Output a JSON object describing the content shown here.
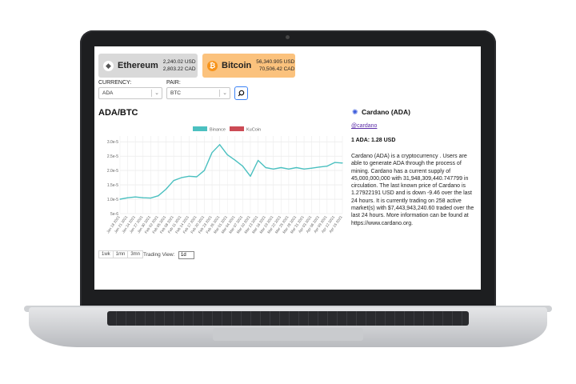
{
  "cards": [
    {
      "name": "Ethereum",
      "icon": "ethereum-icon",
      "usd": "2,240.02 USD",
      "cad": "2,803.22 CAD",
      "color": "#d9d9d9"
    },
    {
      "name": "Bitcoin",
      "icon": "bitcoin-icon",
      "usd": "56,340.905 USD",
      "cad": "70,506.42 CAD",
      "color": "#fbc27d"
    }
  ],
  "filters": {
    "currency_label": "CURRENCY:",
    "currency_value": "ADA",
    "pair_label": "PAIR:",
    "pair_value": "BTC"
  },
  "pair_title": "ADA/BTC",
  "chart_data": {
    "type": "line",
    "title": "",
    "xlabel": "",
    "ylabel": "",
    "legend_position": "top-center",
    "grid": true,
    "ylim": [
      5e-06,
      3.2e-05
    ],
    "y_ticks": [
      "3.0e-5",
      "2.5e-5",
      "2.0e-5",
      "1.5e-5",
      "1.0e-5",
      "5e-6"
    ],
    "y_tick_values": [
      3e-05,
      2.5e-05,
      2e-05,
      1.5e-05,
      1e-05,
      5e-06
    ],
    "categories": [
      "Jan 18 2021",
      "Jan 21 2021",
      "Jan 24 2021",
      "Jan 27 2021",
      "Jan 30 2021",
      "Feb 02 2021",
      "Feb 05 2021",
      "Feb 08 2021",
      "Feb 11 2021",
      "Feb 14 2021",
      "Feb 17 2021",
      "Feb 20 2021",
      "Feb 23 2021",
      "Feb 26 2021",
      "Mar 01 2021",
      "Mar 04 2021",
      "Mar 07 2021",
      "Mar 10 2021",
      "Mar 13 2021",
      "Mar 16 2021",
      "Mar 19 2021",
      "Mar 22 2021",
      "Mar 25 2021",
      "Mar 28 2021",
      "Mar 31 2021",
      "Apr 03 2021",
      "Apr 06 2021",
      "Apr 09 2021",
      "Apr 12 2021",
      "Apr 15 2021"
    ],
    "series": [
      {
        "name": "Binance",
        "color": "#4bc0c0",
        "values": [
          1e-05,
          1.05e-05,
          1.08e-05,
          1.05e-05,
          1.04e-05,
          1.12e-05,
          1.35e-05,
          1.65e-05,
          1.75e-05,
          1.8e-05,
          1.78e-05,
          2e-05,
          2.62e-05,
          2.9e-05,
          2.55e-05,
          2.36e-05,
          2.15e-05,
          1.8e-05,
          2.35e-05,
          2.1e-05,
          2.05e-05,
          2.1e-05,
          2.05e-05,
          2.1e-05,
          2.05e-05,
          2.08e-05,
          2.12e-05,
          2.15e-05,
          2.28e-05,
          2.26e-05
        ]
      },
      {
        "name": "KuCoin",
        "color": "#cc4b55",
        "values": []
      }
    ]
  },
  "range_tabs": [
    "1wk",
    "1mn",
    "3mn"
  ],
  "trading_view": {
    "label": "Trading View:",
    "value": "1d"
  },
  "info": {
    "icon": "cardano-icon",
    "title": "Cardano (ADA)",
    "handle": "@cardano",
    "rate": "1 ADA: 1.28 USD",
    "description": "Cardano (ADA) is a cryptocurrency . Users are able to generate ADA through the process of mining. Cardano has a current supply of 45,000,000,000 with 31,948,309,440.747799 in circulation. The last known price of Cardano is 1.27922191 USD and is down -9.46 over the last 24 hours. It is currently trading on 258 active market(s) with $7,443,943,240.60 traded over the last 24 hours. More information can be found at https://www.cardano.org."
  }
}
